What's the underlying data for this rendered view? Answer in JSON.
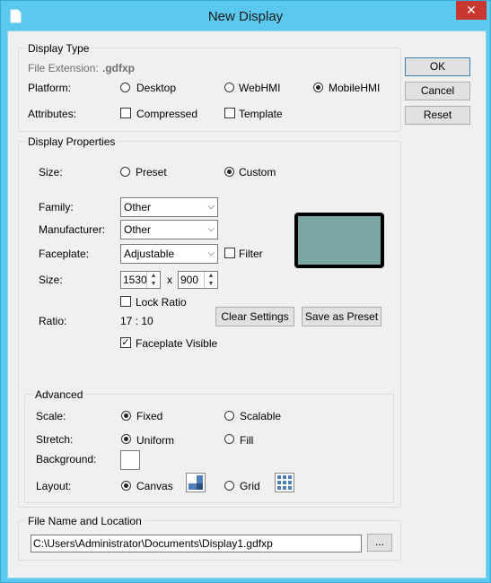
{
  "window": {
    "title": "New Display",
    "close_label": "✕"
  },
  "buttons": {
    "ok": "OK",
    "cancel": "Cancel",
    "reset": "Reset"
  },
  "display_type": {
    "title": "Display Type",
    "file_extension_label": "File Extension:",
    "file_extension_value": ".gdfxp",
    "platform_label": "Platform:",
    "platform_options": [
      "Desktop",
      "WebHMI",
      "MobileHMI"
    ],
    "platform_selected": "MobileHMI",
    "attributes_label": "Attributes:",
    "compressed_label": "Compressed",
    "compressed_checked": false,
    "template_label": "Template",
    "template_checked": false
  },
  "display_properties": {
    "title": "Display Properties",
    "size_label": "Size:",
    "size_options": [
      "Preset",
      "Custom"
    ],
    "size_selected": "Custom",
    "family_label": "Family:",
    "family_value": "Other",
    "manufacturer_label": "Manufacturer:",
    "manufacturer_value": "Other",
    "faceplate_label": "Faceplate:",
    "faceplate_value": "Adjustable",
    "filter_label": "Filter",
    "filter_checked": false,
    "dim_label": "Size:",
    "width_value": "1530",
    "times": "x",
    "height_value": "900",
    "lock_ratio_label": "Lock Ratio",
    "lock_ratio_checked": false,
    "ratio_label": "Ratio:",
    "ratio_value": "17 : 10",
    "clear_settings": "Clear Settings",
    "save_as_preset": "Save as Preset",
    "faceplate_visible_label": "Faceplate Visible",
    "faceplate_visible_checked": true,
    "preview_color": "#7ba6a4"
  },
  "advanced": {
    "title": "Advanced",
    "scale_label": "Scale:",
    "scale_options": [
      "Fixed",
      "Scalable"
    ],
    "scale_selected": "Fixed",
    "stretch_label": "Stretch:",
    "stretch_options": [
      "Uniform",
      "Fill"
    ],
    "stretch_selected": "Uniform",
    "background_label": "Background:",
    "layout_label": "Layout:",
    "layout_options": [
      "Canvas",
      "Grid"
    ],
    "layout_selected": "Canvas"
  },
  "file": {
    "title": "File Name and Location",
    "path": "C:\\Users\\Administrator\\Documents\\Display1.gdfxp",
    "browse_label": "..."
  }
}
